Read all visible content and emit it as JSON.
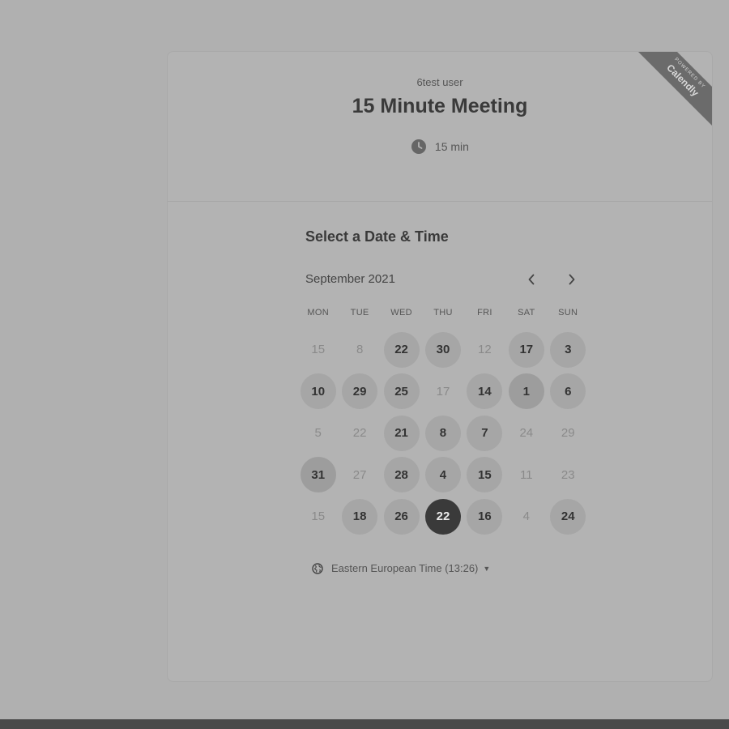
{
  "header": {
    "host_name": "6test user",
    "event_title": "15 Minute Meeting",
    "duration": "15 min",
    "ribbon_top": "POWERED BY",
    "ribbon_brand": "Calendly"
  },
  "picker": {
    "title": "Select a Date & Time",
    "month_label": "September 2021",
    "prev_icon": "chevron-left-icon",
    "next_icon": "chevron-right-icon",
    "weekdays": [
      "MON",
      "TUE",
      "WED",
      "THU",
      "FRI",
      "SAT",
      "SUN"
    ],
    "weeks": [
      [
        {
          "label": "15",
          "state": "unavailable"
        },
        {
          "label": "8",
          "state": "unavailable"
        },
        {
          "label": "22",
          "state": "available"
        },
        {
          "label": "30",
          "state": "available"
        },
        {
          "label": "12",
          "state": "unavailable"
        },
        {
          "label": "17",
          "state": "available"
        },
        {
          "label": "3",
          "state": "available"
        }
      ],
      [
        {
          "label": "10",
          "state": "available"
        },
        {
          "label": "29",
          "state": "available"
        },
        {
          "label": "25",
          "state": "available"
        },
        {
          "label": "17",
          "state": "unavailable"
        },
        {
          "label": "14",
          "state": "available"
        },
        {
          "label": "1",
          "state": "available-soft"
        },
        {
          "label": "6",
          "state": "available"
        }
      ],
      [
        {
          "label": "5",
          "state": "unavailable"
        },
        {
          "label": "22",
          "state": "unavailable"
        },
        {
          "label": "21",
          "state": "available"
        },
        {
          "label": "8",
          "state": "available"
        },
        {
          "label": "7",
          "state": "available"
        },
        {
          "label": "24",
          "state": "unavailable"
        },
        {
          "label": "29",
          "state": "unavailable"
        }
      ],
      [
        {
          "label": "31",
          "state": "available-soft"
        },
        {
          "label": "27",
          "state": "unavailable"
        },
        {
          "label": "28",
          "state": "available"
        },
        {
          "label": "4",
          "state": "available"
        },
        {
          "label": "15",
          "state": "available"
        },
        {
          "label": "11",
          "state": "unavailable"
        },
        {
          "label": "23",
          "state": "unavailable"
        }
      ],
      [
        {
          "label": "15",
          "state": "unavailable"
        },
        {
          "label": "18",
          "state": "available"
        },
        {
          "label": "26",
          "state": "available"
        },
        {
          "label": "22",
          "state": "selected"
        },
        {
          "label": "16",
          "state": "available"
        },
        {
          "label": "4",
          "state": "unavailable"
        },
        {
          "label": "24",
          "state": "available"
        }
      ]
    ],
    "timezone_label": "Eastern European Time (13:26)"
  },
  "colors": {
    "background": "#b0b0b0",
    "selected_day": "#3a3a3a",
    "available_day": "#a6a6a6",
    "ribbon": "#6b6b6b"
  }
}
